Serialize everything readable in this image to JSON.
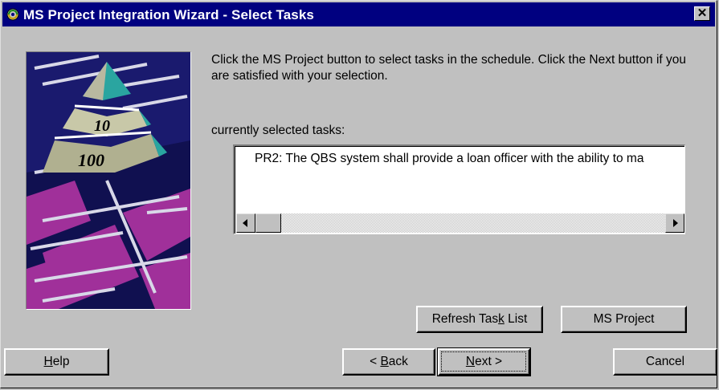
{
  "window": {
    "title": "MS Project Integration Wizard - Select Tasks",
    "close_label": "✕"
  },
  "instructions": "Click the MS Project button to select tasks in the schedule. Click the Next button if you are satisfied with your selection.",
  "selected_tasks": {
    "label": "currently selected tasks:",
    "items": [
      "PR2: The QBS system shall provide a loan officer with the ability to ma"
    ]
  },
  "picture": {
    "pyramid_labels": [
      "10",
      "100"
    ]
  },
  "buttons": {
    "refresh": {
      "before": "Refresh Tas",
      "mnemonic": "k",
      "after": " List"
    },
    "ms_project": "MS Project",
    "help": {
      "mnemonic": "H",
      "after": "elp"
    },
    "back": {
      "before": "< ",
      "mnemonic": "B",
      "after": "ack"
    },
    "next": {
      "mnemonic": "N",
      "after": "ext >"
    },
    "cancel": "Cancel"
  },
  "colors": {
    "titlebar": "#000080",
    "face": "#c0c0c0",
    "picture_bg": "#1a1a6e",
    "picture_magenta": "#a0309a",
    "pyramid_teal": "#2aa5a0"
  }
}
